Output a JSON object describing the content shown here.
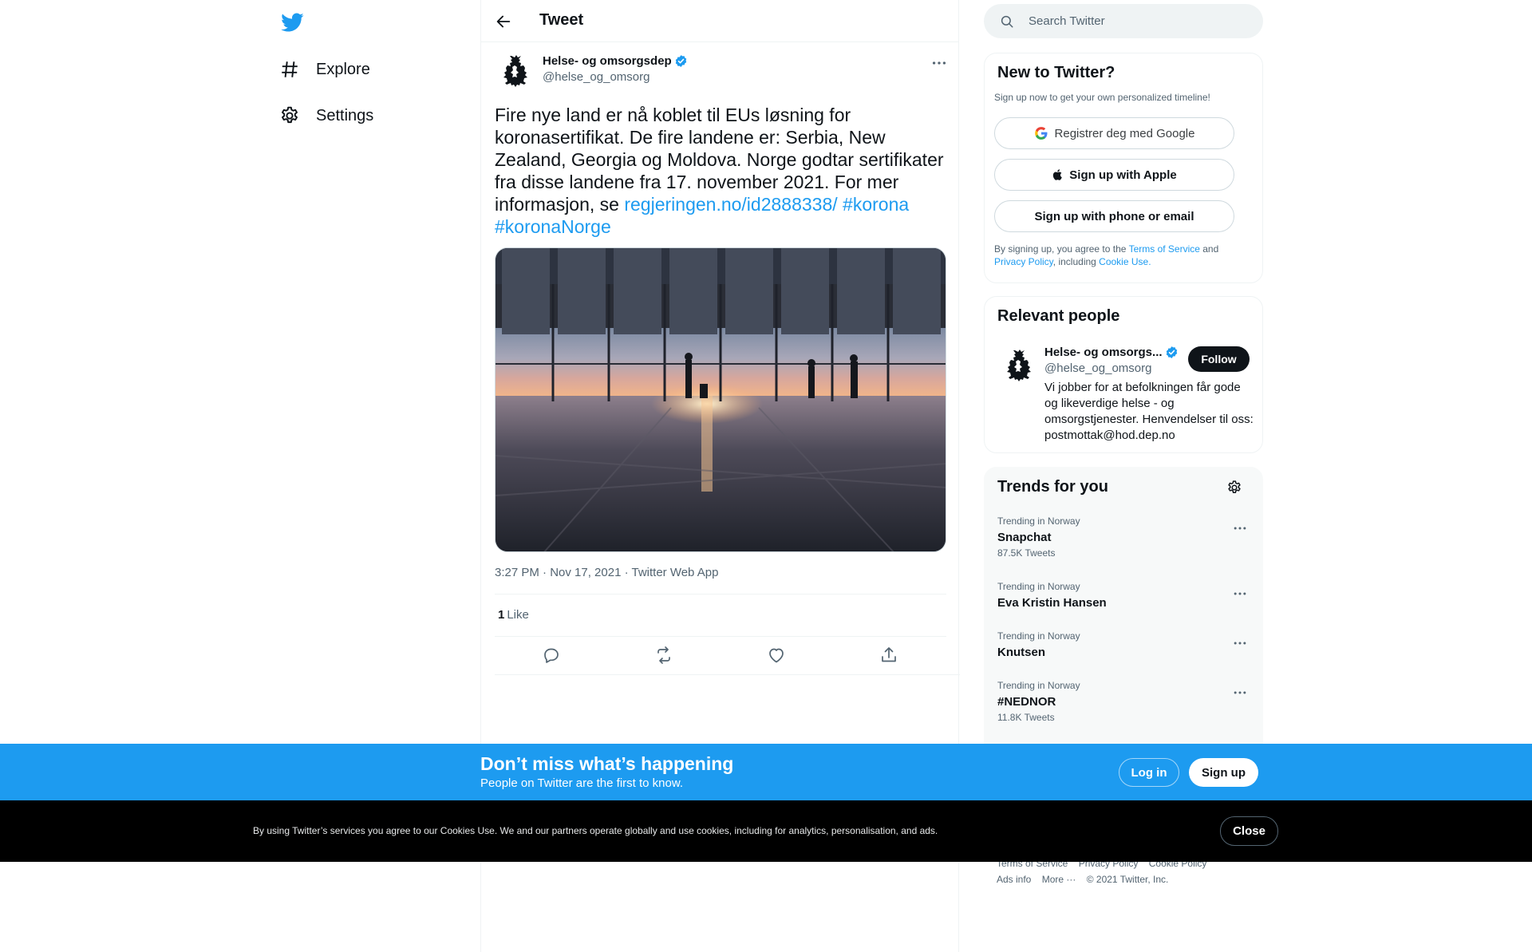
{
  "nav": {
    "logo": "twitter-bird-icon",
    "items": [
      {
        "label": "Explore",
        "icon": "hashtag-icon"
      },
      {
        "label": "Settings",
        "icon": "gear-icon"
      }
    ]
  },
  "header": {
    "title": "Tweet"
  },
  "tweet": {
    "author_name": "Helse- og omsorgsdep",
    "author_handle": "@helse_og_omsorg",
    "text": "Fire nye land er nå koblet til EUs løsning for koronasertifikat. De fire landene er: Serbia, New Zealand, Georgia og Moldova. Norge godtar sertifikater fra disse landene fra 17. november 2021. For mer informasjon, se ",
    "link": "regjeringen.no/id2888338/",
    "hashtag1": "#korona",
    "hashtag2": "#koronaNorge",
    "time": "3:27 PM · Nov 17, 2021 · Twitter Web App",
    "likes_count": "1",
    "likes_label": "Like"
  },
  "search": {
    "placeholder": "Search Twitter"
  },
  "signup_card": {
    "title": "New to Twitter?",
    "subtitle": "Sign up now to get your own personalized timeline!",
    "google": "Registrer deg med Google",
    "apple": "Sign up with Apple",
    "phone": "Sign up with phone or email",
    "legal_1": "By signing up, you agree to the ",
    "tos": "Terms of Service",
    "legal_2": " and ",
    "privacy": "Privacy Policy",
    "legal_3": ", including ",
    "cookie": "Cookie Use."
  },
  "relevant_people": {
    "title": "Relevant people",
    "name": "Helse- og omsorgs...",
    "handle": "@helse_og_omsorg",
    "follow": "Follow",
    "bio": "Vi jobber for at befolkningen får gode og likeverdige helse - og omsorgstjenester. Henvendelser til oss: postmottak@hod.dep.no"
  },
  "trends": {
    "title": "Trends for you",
    "items": [
      {
        "context": "Trending in Norway",
        "name": "Snapchat",
        "count": "87.5K Tweets"
      },
      {
        "context": "Trending in Norway",
        "name": "Eva Kristin Hansen",
        "count": ""
      },
      {
        "context": "Trending in Norway",
        "name": "Knutsen",
        "count": ""
      },
      {
        "context": "Trending in Norway",
        "name": "#NEDNOR",
        "count": "11.8K Tweets"
      }
    ]
  },
  "footer": {
    "tos": "Terms of Service",
    "privacy": "Privacy Policy",
    "cookie": "Cookie Policy",
    "ads": "Ads info",
    "more": "More ···",
    "copyright": "© 2021 Twitter, Inc."
  },
  "bottom_bar": {
    "title": "Don’t miss what’s happening",
    "subtitle": "People on Twitter are the first to know.",
    "login": "Log in",
    "signup": "Sign up"
  },
  "cookie_bar": {
    "text_1": "By using Twitter’s services you agree to our ",
    "link": "Cookies Use",
    "text_2": ". We and our partners operate globally and use cookies, including for analytics, personalisation, and ads.",
    "close": "Close"
  },
  "colors": {
    "accent": "#1d9bf0",
    "text_primary": "#0f1419",
    "text_secondary": "#536471",
    "cookie_bar_bg": "#000000"
  }
}
